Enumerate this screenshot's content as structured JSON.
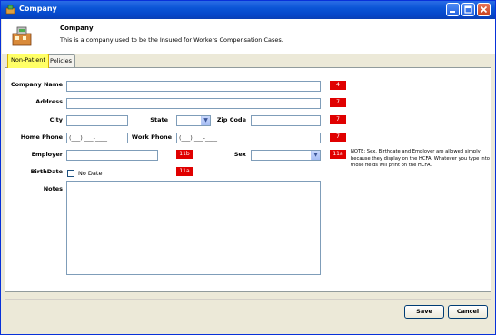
{
  "window": {
    "title": "Company"
  },
  "header": {
    "title": "Company",
    "description": "This is a company used to be the Insured for Workers Compensation Cases."
  },
  "tabs": [
    {
      "label": "Non-Patient",
      "active": true
    },
    {
      "label": "Policies",
      "active": false
    }
  ],
  "form": {
    "company_name": {
      "label": "Company Name",
      "value": "",
      "badge": "4"
    },
    "address": {
      "label": "Address",
      "value": "",
      "badge": "7"
    },
    "city": {
      "label": "City",
      "value": ""
    },
    "state": {
      "label": "State",
      "value": ""
    },
    "zip": {
      "label": "Zip Code",
      "value": "",
      "badge": "7"
    },
    "home_phone": {
      "label": "Home Phone",
      "value": "(___) ___-____"
    },
    "work_phone": {
      "label": "Work Phone",
      "value": "(___) ___-____",
      "badge": "7"
    },
    "employer": {
      "label": "Employer",
      "value": "",
      "badge": "11b"
    },
    "sex": {
      "label": "Sex",
      "value": "",
      "badge": "11a"
    },
    "birthdate": {
      "label": "BirthDate",
      "no_date_label": "No Date",
      "badge": "11a"
    },
    "notes": {
      "label": "Notes",
      "value": ""
    },
    "note_text": "NOTE: Sex, Birthdate and Employer are allowed simply because they display on the HCFA. Whatever you type into those fields will print on the HCFA."
  },
  "buttons": {
    "save": "Save",
    "cancel": "Cancel"
  },
  "colors": {
    "badge": "#e00000",
    "active_tab": "#ffff66",
    "titlebar": "#0a54d6"
  }
}
